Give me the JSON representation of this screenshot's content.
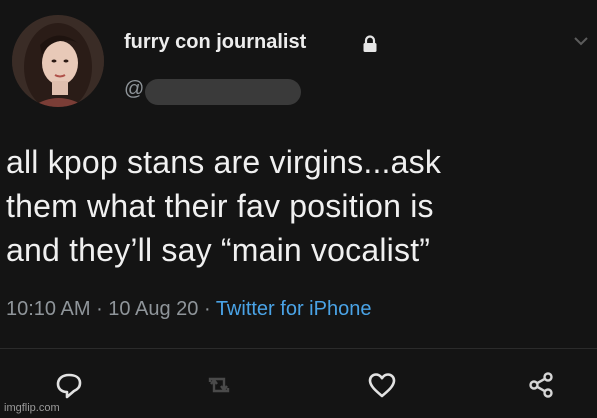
{
  "tweet": {
    "display_name": "furry con journalist",
    "handle_prefix": "@",
    "text": "all kpop stans are virgins...ask\nthem what their fav position is\nand they’ll say “main vocalist”",
    "time": "10:10 AM",
    "separator1": " · ",
    "date": "10 Aug 20",
    "separator2": " · ",
    "source": "Twitter for iPhone"
  },
  "icons": {
    "protected": "lock-icon",
    "menu": "chevron-down-icon",
    "reply": "reply-icon",
    "retweet": "retweet-icon",
    "like": "heart-icon",
    "share": "share-icon"
  },
  "colors": {
    "background": "#141414",
    "text": "#f0f0f0",
    "muted": "#8f959a",
    "link": "#4aa3e6"
  },
  "watermark": "imgflip.com"
}
